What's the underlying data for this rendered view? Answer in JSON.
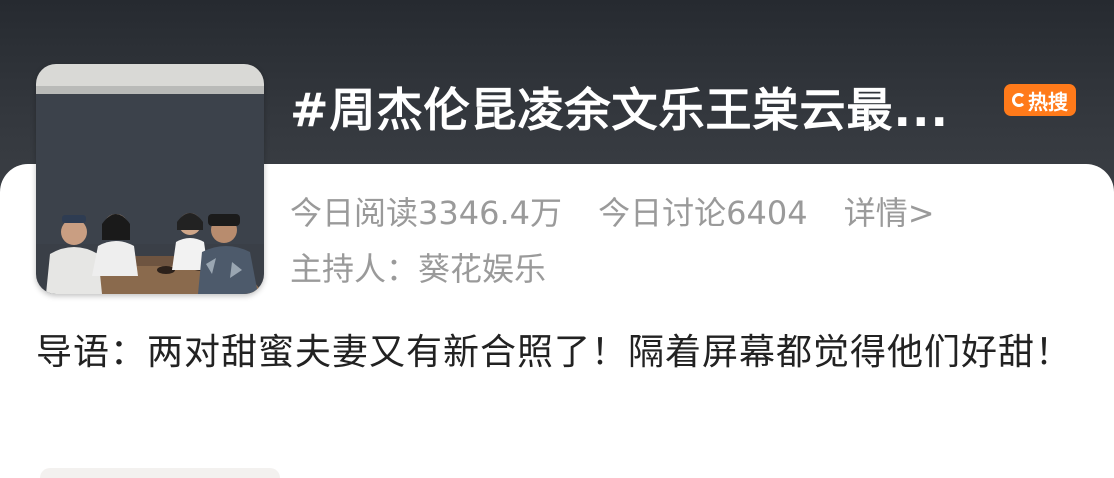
{
  "topic": {
    "title": "#周杰伦昆凌余文乐王棠云最...",
    "badge": "热搜",
    "badge_color": "#ff7a1a"
  },
  "stats": {
    "reads": "今日阅读3346.4万",
    "discussions": "今日讨论6404",
    "details_link": "详情>"
  },
  "host": {
    "label": "主持人：",
    "name": "葵花娱乐"
  },
  "intro": {
    "text": "导语：两对甜蜜夫妻又有新合照了！隔着屏幕都觉得他们好甜！"
  },
  "icons": {
    "badge_icon": "hot-search-icon",
    "thumbnail": "group-photo-image"
  }
}
